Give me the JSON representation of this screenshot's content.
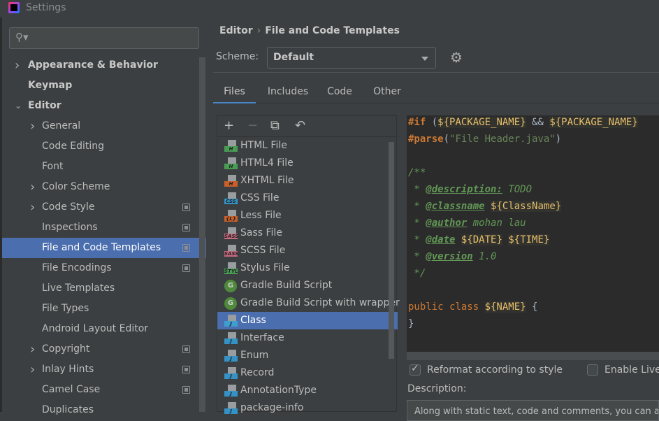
{
  "window": {
    "title": "Settings"
  },
  "sidebar": {
    "search_placeholder": "",
    "items": [
      {
        "label": "Appearance & Behavior",
        "expanded": false,
        "bold": true
      },
      {
        "label": "Keymap",
        "bold": true
      },
      {
        "label": "Editor",
        "expanded": true,
        "bold": true
      },
      {
        "label": "General",
        "expandable": true
      },
      {
        "label": "Code Editing"
      },
      {
        "label": "Font"
      },
      {
        "label": "Color Scheme",
        "expandable": true
      },
      {
        "label": "Code Style",
        "expandable": true,
        "project_icon": true
      },
      {
        "label": "Inspections",
        "project_icon": true
      },
      {
        "label": "File and Code Templates",
        "selected": true,
        "project_icon": true
      },
      {
        "label": "File Encodings",
        "project_icon": true
      },
      {
        "label": "Live Templates"
      },
      {
        "label": "File Types"
      },
      {
        "label": "Android Layout Editor"
      },
      {
        "label": "Copyright",
        "expandable": true,
        "project_icon": true
      },
      {
        "label": "Inlay Hints",
        "expandable": true,
        "project_icon": true
      },
      {
        "label": "Camel Case",
        "project_icon": true
      },
      {
        "label": "Duplicates"
      }
    ]
  },
  "breadcrumb": {
    "parent": "Editor",
    "separator": "›",
    "current": "File and Code Templates"
  },
  "scheme": {
    "label": "Scheme:",
    "value": "Default"
  },
  "tabs": [
    {
      "label": "Files",
      "active": true
    },
    {
      "label": "Includes"
    },
    {
      "label": "Code"
    },
    {
      "label": "Other"
    }
  ],
  "toolbar": {
    "add": "+",
    "remove": "−",
    "copy": "⧉",
    "reset": "↶"
  },
  "templates": [
    {
      "label": "HTML File",
      "badge": "H",
      "color": "#499c54"
    },
    {
      "label": "HTML4 File",
      "badge": "H",
      "color": "#499c54"
    },
    {
      "label": "XHTML File",
      "badge": "H",
      "color": "#c75f2a"
    },
    {
      "label": "CSS File",
      "badge": "CSS",
      "color": "#3592c4"
    },
    {
      "label": "Less File",
      "badge": "{L}",
      "color": "#c75f2a"
    },
    {
      "label": "Sass File",
      "badge": "SASS",
      "color": "#c66a80"
    },
    {
      "label": "SCSS File",
      "badge": "SASS",
      "color": "#c66a80"
    },
    {
      "label": "Stylus File",
      "badge": "STYL",
      "color": "#499c54"
    },
    {
      "label": "Gradle Build Script",
      "badge": "G",
      "gradle": true
    },
    {
      "label": "Gradle Build Script with wrapper",
      "badge": "G",
      "gradle": true
    },
    {
      "label": "Class",
      "badge": "J",
      "color": "#3d9ecf",
      "selected": true
    },
    {
      "label": "Interface",
      "badge": "J",
      "color": "#3592c4"
    },
    {
      "label": "Enum",
      "badge": "J",
      "color": "#3592c4"
    },
    {
      "label": "Record",
      "badge": "J",
      "color": "#3592c4"
    },
    {
      "label": "AnnotationType",
      "badge": "J",
      "color": "#3592c4"
    },
    {
      "label": "package-info",
      "badge": "J",
      "color": "#3592c4"
    }
  ],
  "code": {
    "l1": {
      "a": "#if",
      "b": " (",
      "c": "${PACKAGE_NAME}",
      "d": " && ",
      "e": "${PACKAGE_NAME}"
    },
    "l2": {
      "a": "#parse",
      "b": "(",
      "c": "\"File Header.java\"",
      "d": ")"
    },
    "l4": "/**",
    "l5": {
      "a": " * ",
      "b": "@description:",
      "c": " TODO"
    },
    "l6": {
      "a": " * ",
      "b": "@classname",
      "c": " ",
      "d": "${ClassName}"
    },
    "l7": {
      "a": " * ",
      "b": "@author",
      "c": " mohan lau"
    },
    "l8": {
      "a": " * ",
      "b": "@date",
      "c": " ",
      "d": "${DATE}",
      "e": " ",
      "f": "${TIME}"
    },
    "l9": {
      "a": " * ",
      "b": "@version",
      "c": " 1.0"
    },
    "l10": " */",
    "l12": {
      "a": "public class ",
      "b": "${NAME}",
      "c": " {"
    },
    "l13": "}"
  },
  "options": {
    "reformat": {
      "label": "Reformat according to style",
      "checked": true
    },
    "live": {
      "label": "Enable Live",
      "checked": false
    }
  },
  "description": {
    "label": "Description:",
    "text": "Along with static text, code and comments, you can also"
  }
}
